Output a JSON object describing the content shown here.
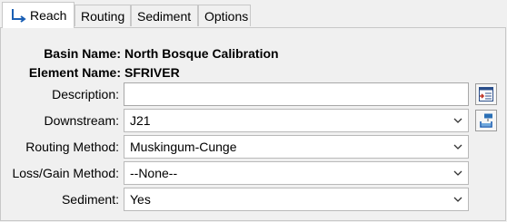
{
  "tabs": [
    {
      "label": "Reach",
      "icon": "reach-icon",
      "active": true
    },
    {
      "label": "Routing"
    },
    {
      "label": "Sediment"
    },
    {
      "label": "Options"
    }
  ],
  "form": {
    "basin_name_label": "Basin Name:",
    "basin_name_value": "North Bosque Calibration",
    "element_name_label": "Element Name:",
    "element_name_value": "SFRIVER",
    "description_label": "Description:",
    "description_value": "",
    "downstream_label": "Downstream:",
    "downstream_value": "J21",
    "routing_method_label": "Routing Method:",
    "routing_method_value": "Muskingum-Cunge",
    "loss_gain_label": "Loss/Gain Method:",
    "loss_gain_value": "--None--",
    "sediment_label": "Sediment:",
    "sediment_value": "Yes"
  },
  "icons": {
    "description_button": "edit-description-icon",
    "downstream_button": "select-element-icon",
    "dropdown": "chevron-down-icon"
  }
}
